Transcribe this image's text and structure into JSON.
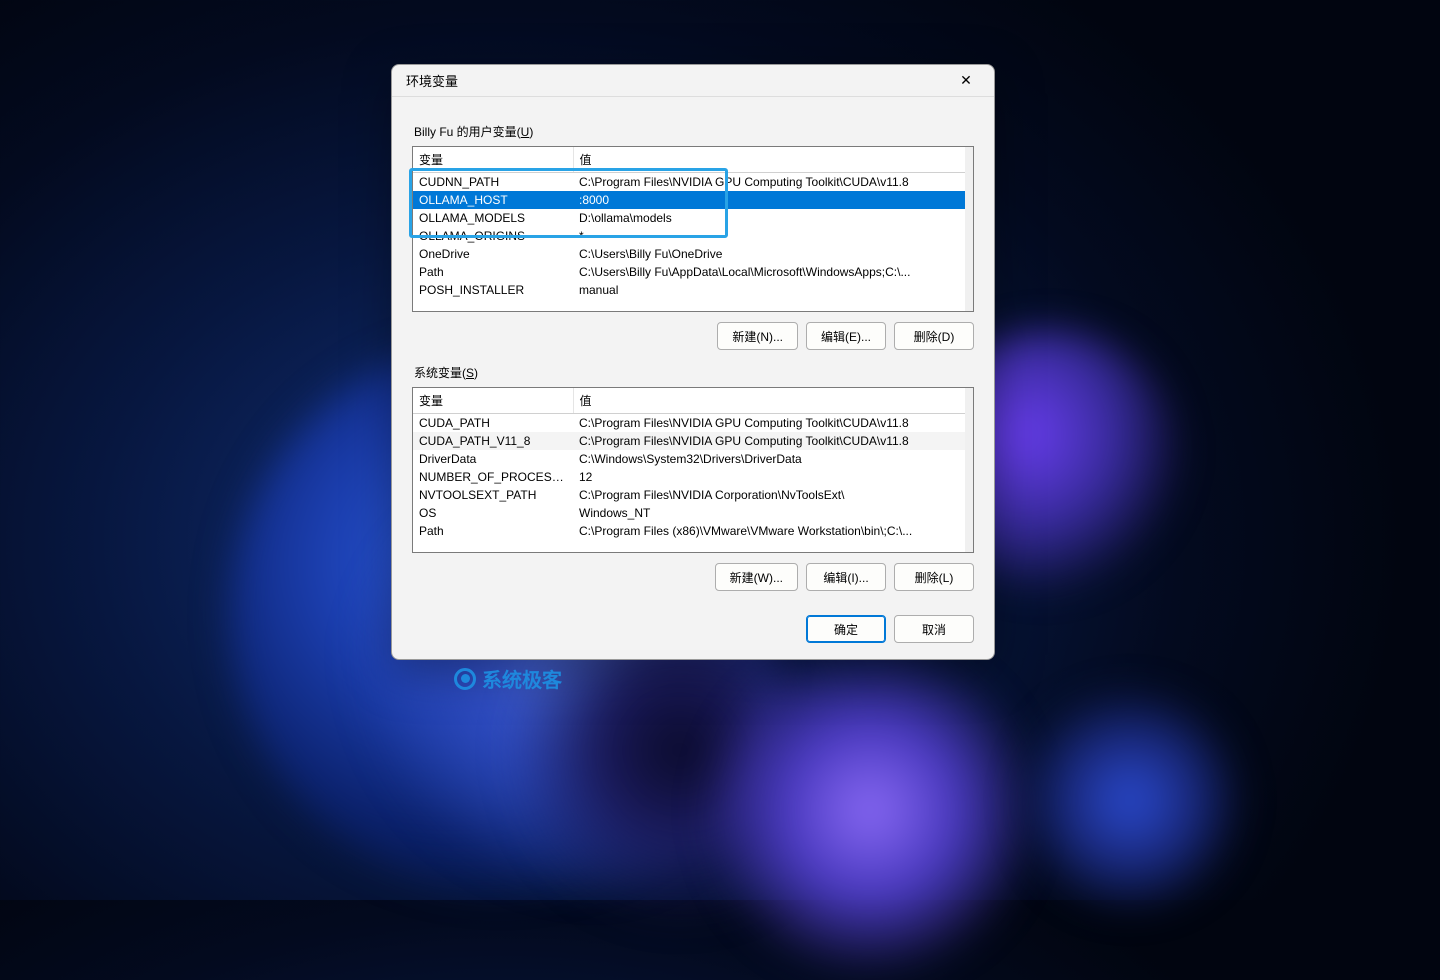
{
  "dialog": {
    "title": "环境变量",
    "close_symbol": "✕"
  },
  "user_section": {
    "label_prefix": "Billy Fu 的用户变量(",
    "label_hotkey": "U",
    "label_suffix": ")",
    "col_name": "变量",
    "col_value": "值",
    "rows": [
      {
        "name": "CUDNN_PATH",
        "value": "C:\\Program Files\\NVIDIA GPU Computing Toolkit\\CUDA\\v11.8"
      },
      {
        "name": "OLLAMA_HOST",
        "value": ":8000"
      },
      {
        "name": "OLLAMA_MODELS",
        "value": "D:\\ollama\\models"
      },
      {
        "name": "OLLAMA_ORIGINS",
        "value": "*"
      },
      {
        "name": "OneDrive",
        "value": "C:\\Users\\Billy Fu\\OneDrive"
      },
      {
        "name": "Path",
        "value": "C:\\Users\\Billy Fu\\AppData\\Local\\Microsoft\\WindowsApps;C:\\..."
      },
      {
        "name": "POSH_INSTALLER",
        "value": "manual"
      }
    ]
  },
  "system_section": {
    "label_prefix": "系统变量(",
    "label_hotkey": "S",
    "label_suffix": ")",
    "col_name": "变量",
    "col_value": "值",
    "rows": [
      {
        "name": "CUDA_PATH",
        "value": "C:\\Program Files\\NVIDIA GPU Computing Toolkit\\CUDA\\v11.8"
      },
      {
        "name": "CUDA_PATH_V11_8",
        "value": "C:\\Program Files\\NVIDIA GPU Computing Toolkit\\CUDA\\v11.8"
      },
      {
        "name": "DriverData",
        "value": "C:\\Windows\\System32\\Drivers\\DriverData"
      },
      {
        "name": "NUMBER_OF_PROCESSORS",
        "value": "12"
      },
      {
        "name": "NVTOOLSEXT_PATH",
        "value": "C:\\Program Files\\NVIDIA Corporation\\NvToolsExt\\"
      },
      {
        "name": "OS",
        "value": "Windows_NT"
      },
      {
        "name": "Path",
        "value": "C:\\Program Files (x86)\\VMware\\VMware Workstation\\bin\\;C:\\..."
      }
    ]
  },
  "buttons": {
    "new_user": "新建(N)...",
    "edit_user": "编辑(E)...",
    "delete_user": "删除(D)",
    "new_sys": "新建(W)...",
    "edit_sys": "编辑(I)...",
    "delete_sys": "删除(L)",
    "ok": "确定",
    "cancel": "取消"
  },
  "watermark": {
    "text": "系统极客"
  }
}
